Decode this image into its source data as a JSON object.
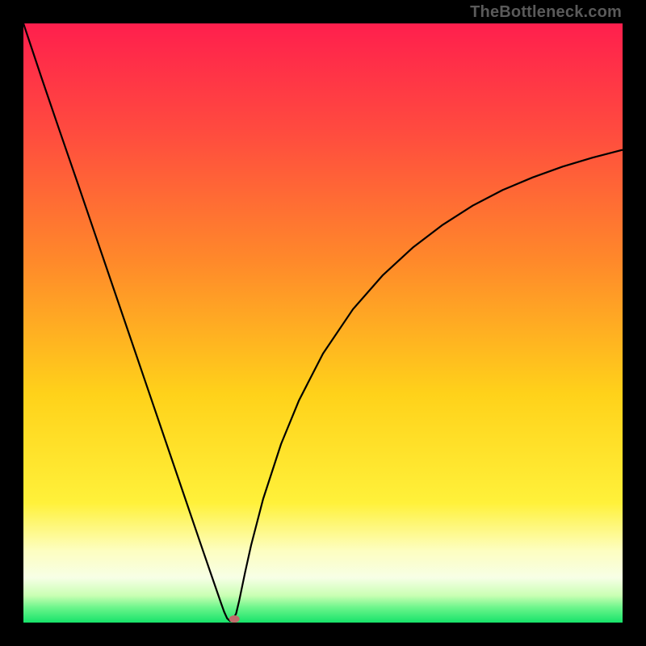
{
  "watermark": "TheBottleneck.com",
  "chart_data": {
    "type": "line",
    "title": "",
    "xlabel": "",
    "ylabel": "",
    "xlim": [
      0,
      100
    ],
    "ylim": [
      0,
      100
    ],
    "series": [
      {
        "name": "bottleneck-curve",
        "color": "#000000",
        "x": [
          0,
          3,
          6,
          9,
          12,
          15,
          18,
          21,
          24,
          27,
          30,
          31,
          32,
          33,
          33.5,
          34,
          34.5,
          35,
          35.5,
          36,
          37,
          38,
          40,
          43,
          46,
          50,
          55,
          60,
          65,
          70,
          75,
          80,
          85,
          90,
          95,
          100
        ],
        "y": [
          100,
          91,
          82.2,
          73.5,
          64.7,
          55.9,
          47.1,
          38.3,
          29.5,
          20.7,
          11.9,
          9,
          6.1,
          3.2,
          1.8,
          0.7,
          0.25,
          0.6,
          1.5,
          3.6,
          8.4,
          12.9,
          20.6,
          29.8,
          37.1,
          44.9,
          52.3,
          58,
          62.6,
          66.4,
          69.6,
          72.2,
          74.3,
          76.1,
          77.6,
          78.9
        ]
      }
    ],
    "marker": {
      "name": "optimal-point",
      "x": 35.2,
      "y": 0.6,
      "color": "#c16a6a",
      "rx": 6.5,
      "ry": 4.5
    },
    "background_gradient": {
      "type": "vertical",
      "stops": [
        {
          "offset": 0.0,
          "color": "#ff1f4d"
        },
        {
          "offset": 0.18,
          "color": "#ff4b3f"
        },
        {
          "offset": 0.4,
          "color": "#ff8a2a"
        },
        {
          "offset": 0.62,
          "color": "#ffd21a"
        },
        {
          "offset": 0.8,
          "color": "#fff13a"
        },
        {
          "offset": 0.88,
          "color": "#fdfec0"
        },
        {
          "offset": 0.925,
          "color": "#f7ffe6"
        },
        {
          "offset": 0.955,
          "color": "#c9ffb3"
        },
        {
          "offset": 0.975,
          "color": "#6cf58b"
        },
        {
          "offset": 1.0,
          "color": "#17e36a"
        }
      ]
    }
  }
}
